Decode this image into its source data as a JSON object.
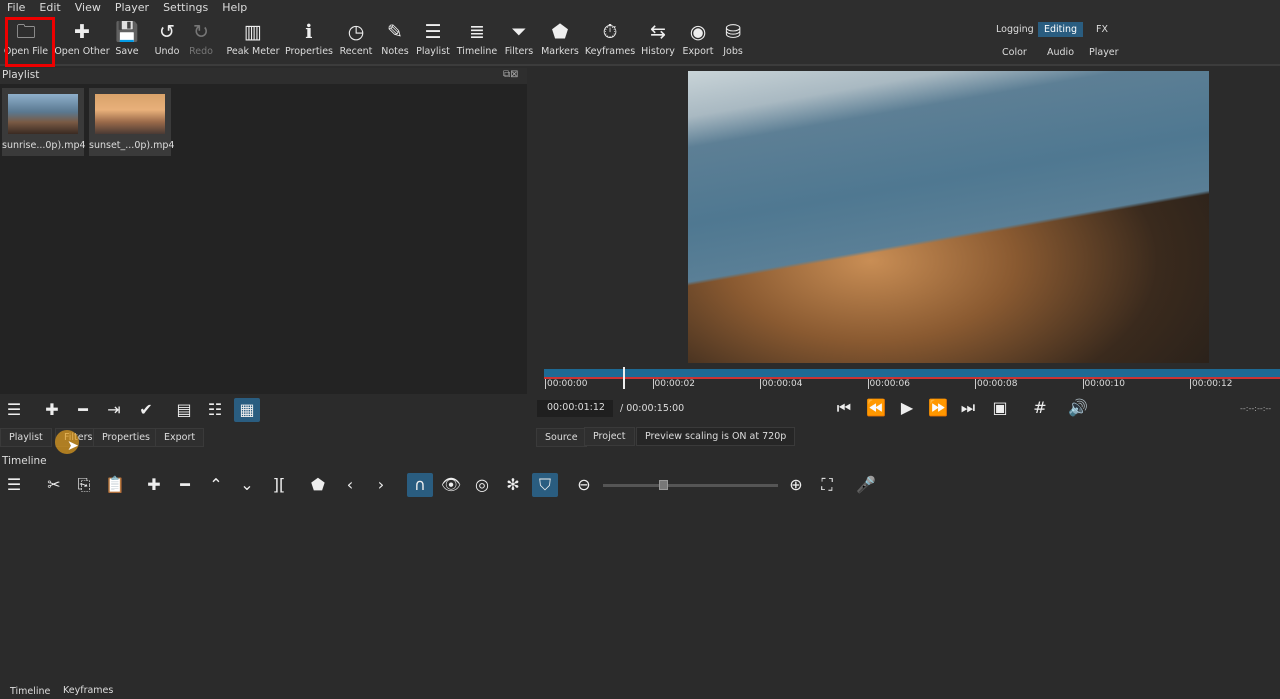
{
  "menu": [
    "File",
    "Edit",
    "View",
    "Player",
    "Settings",
    "Help"
  ],
  "toolbar": [
    {
      "label": "Open File",
      "icon": "folder-icon",
      "glyph": "🗀"
    },
    {
      "label": "Open Other",
      "icon": "open-other-icon",
      "glyph": "✚"
    },
    {
      "label": "Save",
      "icon": "save-icon",
      "glyph": "💾"
    },
    {
      "label": "Undo",
      "icon": "undo-icon",
      "glyph": "↺"
    },
    {
      "label": "Redo",
      "icon": "redo-icon",
      "glyph": "↻"
    },
    {
      "label": "Peak Meter",
      "icon": "peak-meter-icon",
      "glyph": "▥"
    },
    {
      "label": "Properties",
      "icon": "info-icon",
      "glyph": "ℹ"
    },
    {
      "label": "Recent",
      "icon": "clock-icon",
      "glyph": "◷"
    },
    {
      "label": "Notes",
      "icon": "notes-icon",
      "glyph": "✎"
    },
    {
      "label": "Playlist",
      "icon": "list-icon",
      "glyph": "☰"
    },
    {
      "label": "Timeline",
      "icon": "timeline-icon",
      "glyph": "≣"
    },
    {
      "label": "Filters",
      "icon": "filter-icon",
      "glyph": "⏷"
    },
    {
      "label": "Markers",
      "icon": "marker-icon",
      "glyph": "⬟"
    },
    {
      "label": "Keyframes",
      "icon": "stopwatch-icon",
      "glyph": "⏱"
    },
    {
      "label": "History",
      "icon": "history-icon",
      "glyph": "⇆"
    },
    {
      "label": "Export",
      "icon": "disc-icon",
      "glyph": "◉"
    },
    {
      "label": "Jobs",
      "icon": "database-icon",
      "glyph": "⛁"
    }
  ],
  "workspaces": {
    "row1": [
      "Logging",
      "Editing",
      "FX"
    ],
    "row2": [
      "Color",
      "Audio",
      "Player"
    ],
    "active": "Editing"
  },
  "playlist": {
    "title": "Playlist",
    "items": [
      "sunrise...0p).mp4",
      "sunset_...0p).mp4"
    ],
    "tabs": [
      "Playlist",
      "Filters",
      "Properties",
      "Export"
    ]
  },
  "player": {
    "ticks": [
      "00:00:00",
      "00:00:02",
      "00:00:04",
      "00:00:06",
      "00:00:08",
      "00:00:10",
      "00:00:12"
    ],
    "position": "00:00:01:12",
    "duration": "/ 00:00:15:00",
    "right_tc": "--:--:--:--",
    "tabs": [
      "Source",
      "Project"
    ],
    "status": "Preview scaling is ON at 720p"
  },
  "timeline": {
    "title": "Timeline",
    "zoom_level": 0.34
  },
  "bottom_tabs": [
    "Timeline",
    "Keyframes"
  ],
  "colors": {
    "accent": "#2a5d80",
    "highlight": "#e00000"
  }
}
